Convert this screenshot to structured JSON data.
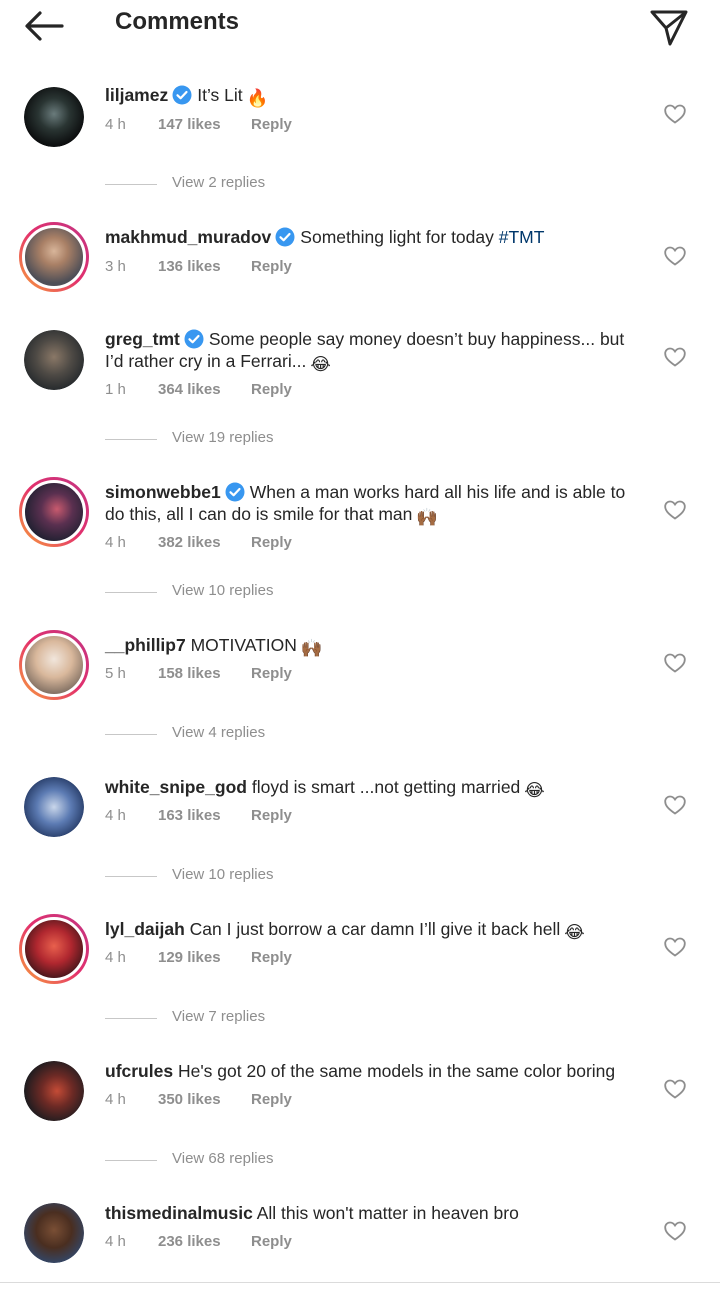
{
  "header": {
    "title": "Comments",
    "back_icon": "arrow-left-icon",
    "send_icon": "paper-plane-icon"
  },
  "colors": {
    "text": "#262626",
    "muted": "#8e8e8e",
    "verified": "#3897f0",
    "link": "#00376b"
  },
  "comments": [
    {
      "username": "liljamez",
      "verified": true,
      "text": "It’s Lit",
      "emoji": "🔥",
      "time": "4 h",
      "likes": "147 likes",
      "reply": "Reply",
      "view_replies": "View 2 replies"
    },
    {
      "username": "makhmud_muradov",
      "verified": true,
      "text": "Something light for today ",
      "hashtag": "#TMT",
      "time": "3 h",
      "likes": "136 likes",
      "reply": "Reply"
    },
    {
      "username": "greg_tmt",
      "verified": true,
      "text": "Some people say money doesn’t buy happiness... but I’d rather cry in a Ferrari...",
      "emoji": "😂",
      "time": "1 h",
      "likes": "364 likes",
      "reply": "Reply",
      "view_replies": "View 19 replies"
    },
    {
      "username": "simonwebbe1",
      "verified": true,
      "text": "When a man works hard all his life and is able to do this, all I can do is smile for that man",
      "emoji": "🙌🏾",
      "time": "4 h",
      "likes": "382 likes",
      "reply": "Reply",
      "view_replies": "View 10 replies"
    },
    {
      "username": "__phillip7",
      "verified": false,
      "text": "MOTIVATION",
      "emoji": "🙌🏾",
      "time": "5 h",
      "likes": "158 likes",
      "reply": "Reply",
      "view_replies": "View 4 replies"
    },
    {
      "username": "white_snipe_god",
      "verified": false,
      "text": "floyd is smart ...not getting married",
      "emoji": "😂",
      "time": "4 h",
      "likes": "163 likes",
      "reply": "Reply",
      "view_replies": "View 10 replies"
    },
    {
      "username": "lyl_daijah",
      "verified": false,
      "text": "Can I just borrow a car damn I’ll give it back hell",
      "emoji": "😂",
      "time": "4 h",
      "likes": "129 likes",
      "reply": "Reply",
      "view_replies": "View 7 replies"
    },
    {
      "username": "ufcrules",
      "verified": false,
      "text": "He's got 20 of the same models in the same color boring",
      "time": "4 h",
      "likes": "350 likes",
      "reply": "Reply",
      "view_replies": "View 68 replies"
    },
    {
      "username": "thismedinalmusic",
      "verified": false,
      "text": "All this won't matter in heaven bro",
      "time": "4 h",
      "likes": "236 likes",
      "reply": "Reply"
    }
  ]
}
